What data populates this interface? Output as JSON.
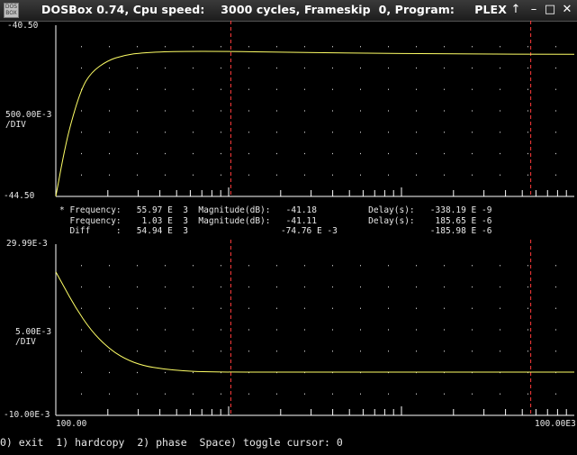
{
  "window": {
    "title": "DOSBox 0.74, Cpu speed:    3000 cycles, Frameskip  0, Program:     PLEX",
    "icon_text": "DOS BOX",
    "buttons": {
      "pin": "↑",
      "minimize": "–",
      "maximize": "□",
      "close": "✕"
    }
  },
  "colors": {
    "background": "#000000",
    "trace": "#ffff66",
    "cursor": "#ff3a3a",
    "text": "#e8e8e8",
    "dots": "#cfcfcf"
  },
  "top_plot": {
    "y_top": "-40.50",
    "y_scale": "500.00E-3",
    "y_scale_unit": "/DIV",
    "y_bottom": "-44.50"
  },
  "bottom_plot": {
    "y_top": "29.99E-3",
    "y_scale": "5.00E-3",
    "y_scale_unit": "/DIV",
    "y_bottom": "-10.00E-3"
  },
  "readout": {
    "row1": "* Frequency:   55.97 E  3  Magnitude(dB):   -41.18          Delay(s):   -338.19 E -9",
    "row2": "  Frequency:    1.03 E  3  Magnitude(dB):   -41.11          Delay(s):    185.65 E -6",
    "row3": "  Diff     :   54.94 E  3                  -74.76 E -3                  -185.98 E -6"
  },
  "x_axis": {
    "start": "100.00",
    "end": "100.00E3"
  },
  "menu": "0) exit  1) hardcopy  2) phase  Space) toggle cursor: 0",
  "chart_data": [
    {
      "type": "line",
      "title": "",
      "xlabel": "",
      "ylabel": "",
      "x_scale": "log",
      "xlim": [
        100,
        100000
      ],
      "ylim": [
        -44.5,
        -40.5
      ],
      "y_per_div": 0.5,
      "cursors_x": [
        1030,
        55970
      ],
      "series": [
        {
          "x": [
            100,
            110,
            120,
            140,
            160,
            200,
            250,
            320,
            500,
            1000,
            2000,
            5000,
            20000,
            100000
          ],
          "y": [
            -44.5,
            -43.6,
            -42.9,
            -42.0,
            -41.6,
            -41.32,
            -41.2,
            -41.14,
            -41.11,
            -41.11,
            -41.13,
            -41.15,
            -41.17,
            -41.18
          ]
        }
      ]
    },
    {
      "type": "line",
      "title": "",
      "xlabel": "",
      "ylabel": "",
      "x_scale": "log",
      "xlim": [
        100,
        100000
      ],
      "ylim": [
        -0.01,
        0.02999
      ],
      "y_per_div": 0.005,
      "cursors_x": [
        1030,
        55970
      ],
      "series": [
        {
          "x": [
            100,
            110,
            130,
            160,
            200,
            250,
            320,
            420,
            550,
            700,
            1000,
            2000,
            10000,
            100000
          ],
          "y": [
            0.0235,
            0.0205,
            0.0152,
            0.0098,
            0.0058,
            0.0032,
            0.0016,
            0.0008,
            0.0004,
            0.0002,
            0.0001,
            0.0001,
            0.0001,
            0.0001
          ]
        }
      ]
    }
  ]
}
